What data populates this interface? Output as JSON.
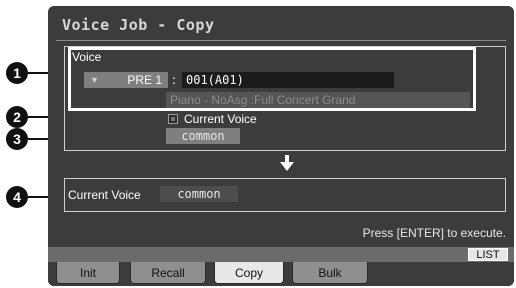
{
  "screen": {
    "title": "Voice Job - Copy",
    "voice_section": {
      "label": "Voice",
      "bank": "PRE 1",
      "colon": ":",
      "number": "001(A01)",
      "name": "Piano - NoAsg  :Full Concert Grand"
    },
    "current_voice_checkbox": {
      "label": "Current Voice",
      "checked": false
    },
    "source_element": "common",
    "destination": {
      "label": "Current Voice",
      "element": "common"
    },
    "execute_message": "Press [ENTER] to execute.",
    "list_button": "LIST",
    "tabs": [
      {
        "label": "Init",
        "active": false
      },
      {
        "label": "Recall",
        "active": false
      },
      {
        "label": "Copy",
        "active": true
      },
      {
        "label": "Bulk",
        "active": false
      }
    ]
  },
  "callouts": [
    "1",
    "2",
    "3",
    "4"
  ],
  "colors": {
    "screen_bg": "#3c3c3c",
    "highlight_box": "#ffffff",
    "field_bg": "#7f7f7f"
  },
  "icons": {
    "down_arrow": "down-arrow-icon",
    "dropdown": "triangle-down-icon",
    "checkbox": "checkbox-icon"
  }
}
